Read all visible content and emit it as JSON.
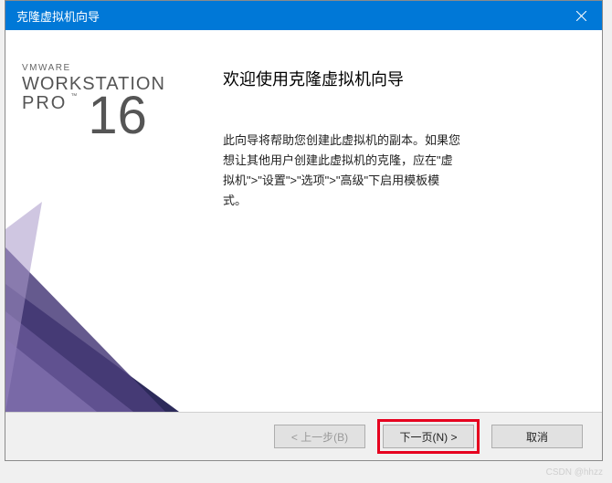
{
  "titlebar": {
    "title": "克隆虚拟机向导"
  },
  "brand": {
    "company": "VMWARE",
    "product": "WORKSTATION",
    "edition": "PRO",
    "tm": "™",
    "version": "16"
  },
  "main": {
    "heading": "欢迎使用克隆虚拟机向导",
    "body": "此向导将帮助您创建此虚拟机的副本。如果您想让其他用户创建此虚拟机的克隆，应在\"虚拟机\">\"设置\">\"选项\">\"高级\"下启用模板模式。"
  },
  "buttons": {
    "back": "< 上一步(B)",
    "next": "下一页(N) >",
    "cancel": "取消"
  },
  "watermark": "CSDN @hhzz"
}
